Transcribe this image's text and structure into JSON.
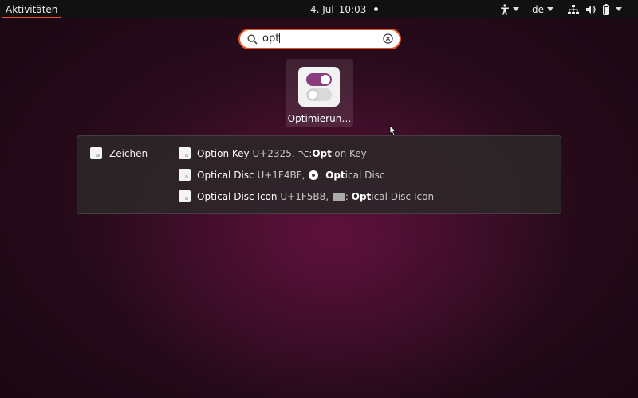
{
  "topbar": {
    "activities_label": "Aktivitäten",
    "date": "4. Jul",
    "time": "10:03",
    "keyboard_layout": "de",
    "accent_color": "#e95420"
  },
  "search": {
    "value": "opt",
    "icon": "search-icon",
    "clear_icon": "clear-icon"
  },
  "apps": [
    {
      "label": "Optimierun…",
      "icon": "toggle-switches-icon"
    }
  ],
  "characters_provider": {
    "name": "Zeichen",
    "results": [
      {
        "name": "Option Key",
        "code": "U+2325,",
        "symbol": "⌥:",
        "match": "Opt",
        "rest": "ion Key"
      },
      {
        "name": "Optical Disc",
        "code": "U+1F4BF,",
        "symbol": ":",
        "match": "Opt",
        "rest": "ical Disc"
      },
      {
        "name": "Optical Disc Icon",
        "code": "U+1F5B8,",
        "symbol": ":",
        "match": "Opt",
        "rest": "ical Disc Icon"
      }
    ]
  }
}
